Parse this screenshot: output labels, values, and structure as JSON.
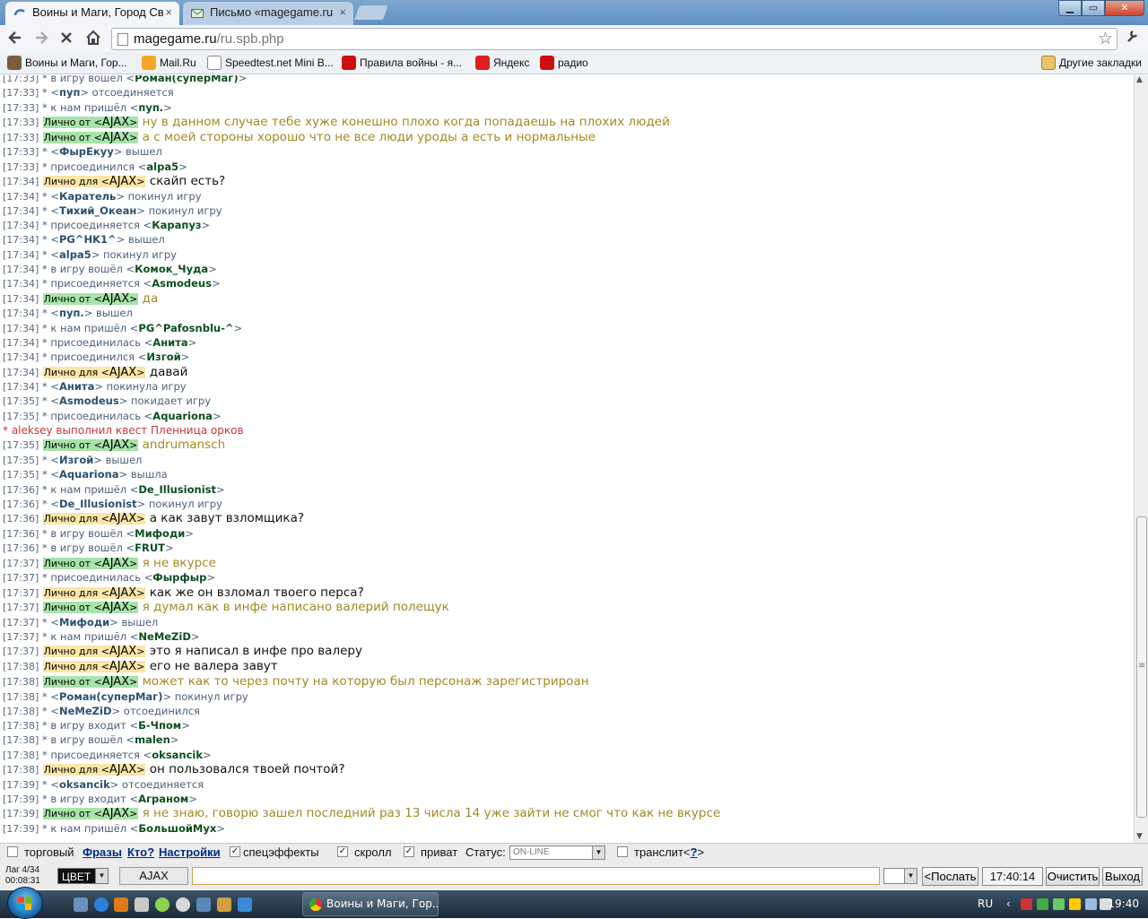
{
  "browser": {
    "tabs": [
      {
        "label": "Воины и Маги, Город Св"
      },
      {
        "label": "Письмо «magegame.ru"
      }
    ],
    "tab_close": "×",
    "address": {
      "domain": "magegame.ru",
      "path": "/ru.spb.php"
    },
    "window_controls": {
      "minimize": "▁",
      "maximize": "▭",
      "close": "✕"
    },
    "bookmarks": [
      {
        "label": "Воины и Маги, Гор...",
        "color": "#7a5c3c"
      },
      {
        "label": "Mail.Ru",
        "color": "#f5a623"
      },
      {
        "label": "Speedtest.net Mini B...",
        "color": "#ffffff"
      },
      {
        "label": "Правила войны - я...",
        "color": "#cc1111"
      },
      {
        "label": "Яндекс",
        "color": "#e02020"
      },
      {
        "label": "радио",
        "color": "#cc1010"
      }
    ],
    "other_bookmarks": "Другие закладки"
  },
  "chat": {
    "lines": [
      {
        "time": "[17:33]",
        "type": "sys",
        "pre": "* в игру вошёл <",
        "nick": "Роман(суперМаг)",
        "post": ">"
      },
      {
        "time": "[17:33]",
        "type": "sysb",
        "pre": "* <",
        "nick": "пуп",
        "post": "> отсоединяется"
      },
      {
        "time": "[17:33]",
        "type": "sys",
        "pre": "* к нам пришёл <",
        "nick": "пуп.",
        "post": ">"
      },
      {
        "time": "[17:33]",
        "type": "from",
        "tag": "Лично от",
        "nick": "AJAX",
        "text": "ну в данном случае тебе хуже конешно плохо когда попадаешь на плохих людей"
      },
      {
        "time": "[17:33]",
        "type": "from",
        "tag": "Лично от",
        "nick": "AJAX",
        "text": "а с моей стороны хорошо что не все люди уроды а есть и нормальные"
      },
      {
        "time": "[17:33]",
        "type": "sysb",
        "pre": "* <",
        "nick": "ФырЕкуу",
        "post": "> вышел"
      },
      {
        "time": "[17:33]",
        "type": "sys",
        "pre": "* присоединился <",
        "nick": "alpa5",
        "post": ">"
      },
      {
        "time": "[17:34]",
        "type": "to",
        "tag": "Лично для",
        "nick": "AJAX",
        "text": "скайп есть?"
      },
      {
        "time": "[17:34]",
        "type": "sysb",
        "pre": "* <",
        "nick": "Каратель",
        "post": "> покинул игру"
      },
      {
        "time": "[17:34]",
        "type": "sysb",
        "pre": "* <",
        "nick": "Тихий_Океан",
        "post": "> покинул игру"
      },
      {
        "time": "[17:34]",
        "type": "sys",
        "pre": "* присоединяется <",
        "nick": "Карапуз",
        "post": ">"
      },
      {
        "time": "[17:34]",
        "type": "sysb",
        "pre": "* <",
        "nick": "PG^HK1^",
        "post": "> вышел"
      },
      {
        "time": "[17:34]",
        "type": "sysb",
        "pre": "* <",
        "nick": "alpa5",
        "post": "> покинул игру"
      },
      {
        "time": "[17:34]",
        "type": "sys",
        "pre": "* в игру вошёл <",
        "nick": "Комок_Чуда",
        "post": ">"
      },
      {
        "time": "[17:34]",
        "type": "sys",
        "pre": "* присоединяется <",
        "nick": "Asmodeus",
        "post": ">"
      },
      {
        "time": "[17:34]",
        "type": "from",
        "tag": "Лично от",
        "nick": "AJAX",
        "text": "да"
      },
      {
        "time": "[17:34]",
        "type": "sysb",
        "pre": "* <",
        "nick": "пуп.",
        "post": "> вышел"
      },
      {
        "time": "[17:34]",
        "type": "sys",
        "pre": "* к нам пришёл <",
        "nick": "PG^Pafosnblu-^",
        "post": ">"
      },
      {
        "time": "[17:34]",
        "type": "sys",
        "pre": "* присоединилась <",
        "nick": "Анита",
        "post": ">"
      },
      {
        "time": "[17:34]",
        "type": "sys",
        "pre": "* присоединился <",
        "nick": "Изгой",
        "post": ">"
      },
      {
        "time": "[17:34]",
        "type": "to",
        "tag": "Лично для",
        "nick": "AJAX",
        "text": "давай"
      },
      {
        "time": "[17:34]",
        "type": "sysb",
        "pre": "* <",
        "nick": "Анита",
        "post": "> покинула игру"
      },
      {
        "time": "[17:35]",
        "type": "sysb",
        "pre": "* <",
        "nick": "Asmodeus",
        "post": "> покидает игру"
      },
      {
        "time": "[17:35]",
        "type": "sys",
        "pre": "* присоединилась <",
        "nick": "Aquariona",
        "post": ">"
      },
      {
        "time": "",
        "type": "quest",
        "text": "* aleksey выполнил квест Пленница орков"
      },
      {
        "time": "[17:35]",
        "type": "from",
        "tag": "Лично от",
        "nick": "AJAX",
        "text": "andrumansch"
      },
      {
        "time": "[17:35]",
        "type": "sysb",
        "pre": "* <",
        "nick": "Изгой",
        "post": "> вышел"
      },
      {
        "time": "[17:35]",
        "type": "sysb",
        "pre": "* <",
        "nick": "Aquariona",
        "post": "> вышла"
      },
      {
        "time": "[17:36]",
        "type": "sys",
        "pre": "* к нам пришёл <",
        "nick": "De_Illusionist",
        "post": ">"
      },
      {
        "time": "[17:36]",
        "type": "sysb",
        "pre": "* <",
        "nick": "De_Illusionist",
        "post": "> покинул игру"
      },
      {
        "time": "[17:36]",
        "type": "to",
        "tag": "Лично для",
        "nick": "AJAX",
        "text": "а как завут взломщика?"
      },
      {
        "time": "[17:36]",
        "type": "sys",
        "pre": "* в игру вошёл <",
        "nick": "Мифоди",
        "post": ">"
      },
      {
        "time": "[17:36]",
        "type": "sys",
        "pre": "* в игру вошёл <",
        "nick": "FRUT",
        "post": ">"
      },
      {
        "time": "[17:37]",
        "type": "from",
        "tag": "Лично от",
        "nick": "AJAX",
        "text": "я не вкурсе"
      },
      {
        "time": "[17:37]",
        "type": "sys",
        "pre": "* присоединилась <",
        "nick": "Фырфыр",
        "post": ">"
      },
      {
        "time": "[17:37]",
        "type": "to",
        "tag": "Лично для",
        "nick": "AJAX",
        "text": "как же он взломал твоего перса?"
      },
      {
        "time": "[17:37]",
        "type": "from",
        "tag": "Лично от",
        "nick": "AJAX",
        "text": "я думал как в инфе написано валерий полещук"
      },
      {
        "time": "[17:37]",
        "type": "sysb",
        "pre": "* <",
        "nick": "Мифоди",
        "post": "> вышел"
      },
      {
        "time": "[17:37]",
        "type": "sys",
        "pre": "* к нам пришёл <",
        "nick": "NeMeZiD",
        "post": ">"
      },
      {
        "time": "[17:37]",
        "type": "to",
        "tag": "Лично для",
        "nick": "AJAX",
        "text": "это я написал в инфе про валеру"
      },
      {
        "time": "[17:38]",
        "type": "to",
        "tag": "Лично для",
        "nick": "AJAX",
        "text": "его не валера завут"
      },
      {
        "time": "[17:38]",
        "type": "from",
        "tag": "Лично от",
        "nick": "AJAX",
        "text": "может как то через почту на которую был персонаж зарегистрироан"
      },
      {
        "time": "[17:38]",
        "type": "sysb",
        "pre": "* <",
        "nick": "Роман(суперМаг)",
        "post": "> покинул игру"
      },
      {
        "time": "[17:38]",
        "type": "sysb",
        "pre": "* <",
        "nick": "NeMeZiD",
        "post": "> отсоединился"
      },
      {
        "time": "[17:38]",
        "type": "sys",
        "pre": "* в игру входит <",
        "nick": "Б-Чпом",
        "post": ">"
      },
      {
        "time": "[17:38]",
        "type": "sys",
        "pre": "* в игру вошёл <",
        "nick": "malen",
        "post": ">"
      },
      {
        "time": "[17:38]",
        "type": "sys",
        "pre": "* присоединяется <",
        "nick": "oksancik",
        "post": ">"
      },
      {
        "time": "[17:38]",
        "type": "to",
        "tag": "Лично для",
        "nick": "AJAX",
        "text": "он пользовался твоей почтой?"
      },
      {
        "time": "[17:39]",
        "type": "sysb",
        "pre": "* <",
        "nick": "oksancik",
        "post": "> отсоединяется"
      },
      {
        "time": "[17:39]",
        "type": "sys",
        "pre": "* в игру входит <",
        "nick": "Аграном",
        "post": ">"
      },
      {
        "time": "[17:39]",
        "type": "from",
        "tag": "Лично от",
        "nick": "AJAX",
        "text": "я не знаю, говорю зашел последний раз 13 числа 14 уже зайти не смог что как не вкурсе"
      },
      {
        "time": "[17:39]",
        "type": "sys",
        "pre": "* к нам пришёл <",
        "nick": "БольшойМух",
        "post": ">"
      }
    ]
  },
  "options": {
    "trade": {
      "label": "торговый",
      "checked": ""
    },
    "phrases": "Фразы",
    "who": "Кто?",
    "settings": "Настройки",
    "effects": {
      "label": "спецэффекты",
      "checked": "✓"
    },
    "scroll": {
      "label": "скролл",
      "checked": "✓"
    },
    "private": {
      "label": "приват",
      "checked": "✓"
    },
    "status_label": "Статус:",
    "status_value": "ON-LINE",
    "translit": {
      "label": "транслит",
      "checked": ""
    },
    "translit_help_open": "<",
    "translit_help": "?",
    "translit_help_close": ">"
  },
  "input_row": {
    "lag_line1": "Лаг 4/34",
    "lag_line2": "00:08:31",
    "color_label": "ЦВЕТ",
    "nick": "AJAX",
    "message_value": "",
    "send": "<Послать",
    "clock": "17:40:14",
    "clear": "Очистить",
    "exit": "Выход"
  },
  "taskbar": {
    "window_title": "Воины и Маги, Гор...",
    "lang": "RU",
    "time": "19:40"
  }
}
